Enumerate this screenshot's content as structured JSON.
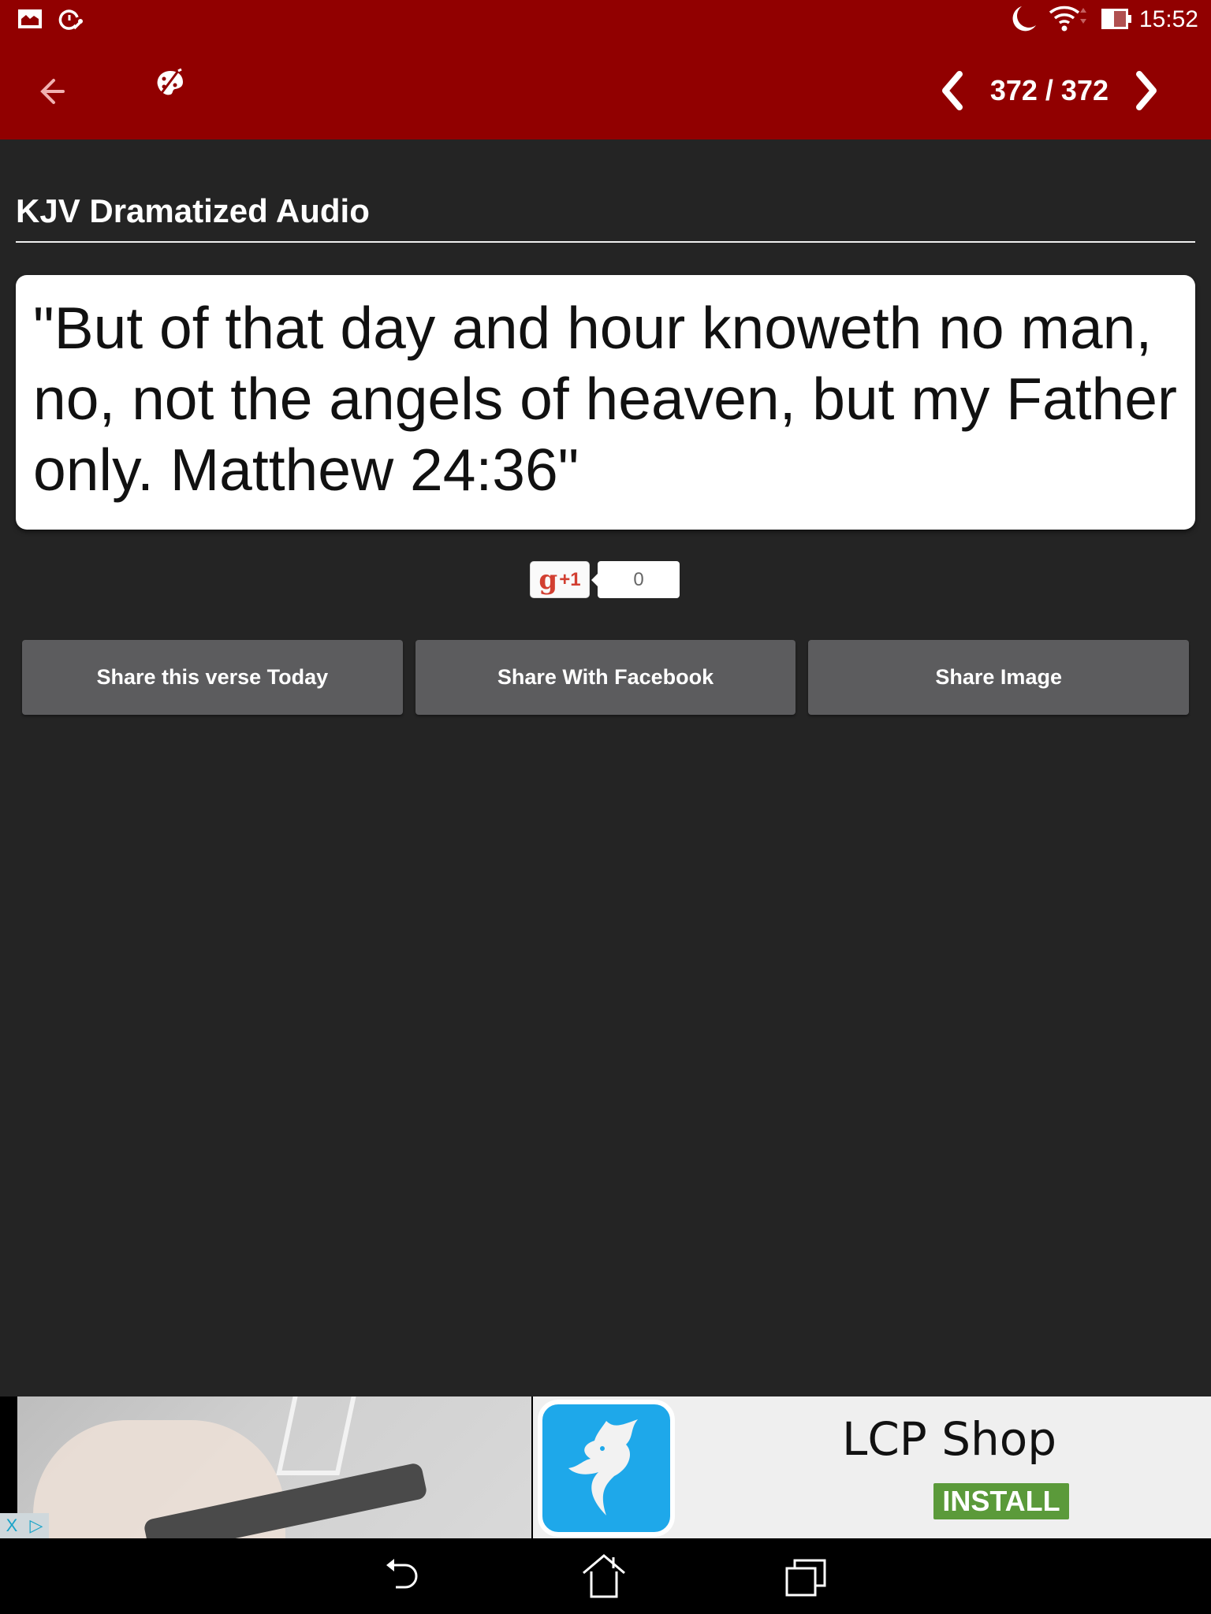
{
  "status_bar": {
    "time": "15:52",
    "left_icons": [
      "gallery-icon",
      "speed-tool-icon"
    ],
    "right_icons": [
      "moon-icon",
      "wifi-icon",
      "battery-icon"
    ]
  },
  "app_bar": {
    "back_icon": "arrow-left-icon",
    "theme_icon": "palette-icon",
    "pager": {
      "current": 372,
      "total": 372,
      "label": "372 / 372"
    }
  },
  "content": {
    "title": "KJV Dramatized Audio",
    "verse": "\"But of that day and hour knoweth no man, no, not the angels of heaven, but my Father only. Matthew 24:36\"",
    "gplus": {
      "label_g": "g",
      "label_plus": "+1",
      "count": "0"
    },
    "share_buttons": [
      {
        "label": "Share this verse Today"
      },
      {
        "label": "Share With Facebook"
      },
      {
        "label": "Share Image"
      }
    ]
  },
  "ad": {
    "app_name": "LCP Shop",
    "cta": "INSTALL",
    "adchoices_close": "X",
    "adchoices_info": "▷"
  },
  "nav_bar": {
    "buttons": [
      "back-icon",
      "home-icon",
      "recents-icon"
    ]
  },
  "colors": {
    "brand": "#910000",
    "background": "#242424",
    "button": "#5c5c5e",
    "install": "#5b9a3a",
    "ad_icon": "#1ea8ea"
  }
}
